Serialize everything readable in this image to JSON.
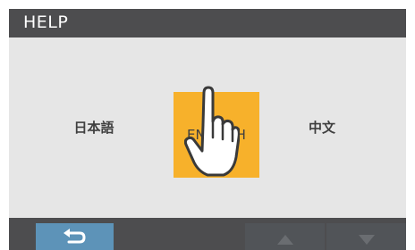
{
  "header": {
    "title": "HELP"
  },
  "languages": {
    "japanese": "日本語",
    "english": "ENGLISH",
    "chinese": "中文"
  },
  "footer": {
    "back_icon": "return-arrow-icon",
    "up_icon": "triangle-up-icon",
    "down_icon": "triangle-down-icon"
  },
  "colors": {
    "header_bg": "#4d4d4f",
    "content_bg": "#e6e6e6",
    "selected_bg": "#f7b12b",
    "back_button": "#5d93b8"
  }
}
